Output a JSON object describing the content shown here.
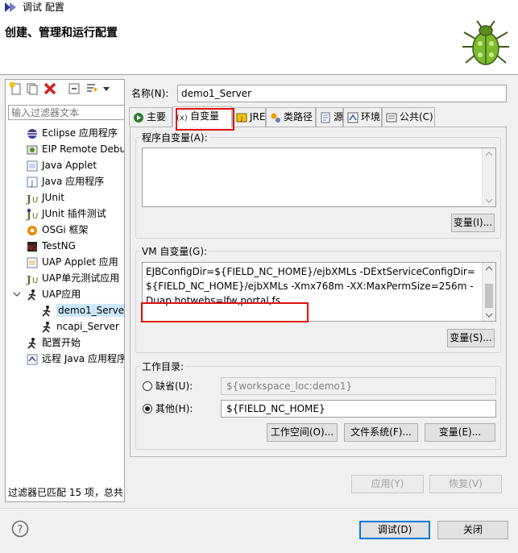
{
  "window": {
    "title": "调试 配置"
  },
  "header": {
    "title": "创建、管理和运行配置"
  },
  "filter": {
    "placeholder": "输入过滤器文本"
  },
  "tree": {
    "items": [
      {
        "label": "Eclipse 应用程序",
        "icon": "eclipse-icon",
        "level": 1
      },
      {
        "label": "EIP Remote Debu",
        "icon": "eip-remote-debug-icon",
        "level": 1
      },
      {
        "label": "Java Applet",
        "icon": "java-applet-icon",
        "level": 1
      },
      {
        "label": "Java 应用程序",
        "icon": "java-application-icon",
        "level": 1
      },
      {
        "label": "JUnit",
        "icon": "junit-icon",
        "level": 1
      },
      {
        "label": "JUnit 插件测试",
        "icon": "junit-plugin-icon",
        "level": 1
      },
      {
        "label": "OSGi 框架",
        "icon": "osgi-icon",
        "level": 1
      },
      {
        "label": "TestNG",
        "icon": "testng-icon",
        "level": 1
      },
      {
        "label": "UAP Applet 应用",
        "icon": "uap-applet-icon",
        "level": 1
      },
      {
        "label": "UAP单元测试应用",
        "icon": "uap-unit-test-icon",
        "level": 1
      },
      {
        "label": "UAP应用",
        "icon": "uap-app-icon",
        "level": 1,
        "expanded": true
      },
      {
        "label": "demo1_Serve",
        "icon": "runner-icon",
        "level": 2,
        "selected": true
      },
      {
        "label": "ncapi_Server",
        "icon": "runner-icon",
        "level": 2
      },
      {
        "label": "配置开始",
        "icon": "config-start-icon",
        "level": 1
      },
      {
        "label": "远程 Java 应用程序",
        "icon": "remote-java-icon",
        "level": 1
      }
    ]
  },
  "left_status": "过滤器已匹配 15 项，总共",
  "name": {
    "label": "名称(N):",
    "value": "demo1_Server"
  },
  "tabs": [
    {
      "label": "主要",
      "icon": "main-tab-icon"
    },
    {
      "label": "自变量",
      "icon": "arguments-tab-icon",
      "active": true
    },
    {
      "label": "JRE",
      "icon": "jre-tab-icon"
    },
    {
      "label": "类路径",
      "icon": "classpath-tab-icon"
    },
    {
      "label": "源",
      "icon": "source-tab-icon"
    },
    {
      "label": "环境",
      "icon": "environment-tab-icon"
    },
    {
      "label": "公共(C)",
      "icon": "common-tab-icon"
    }
  ],
  "program_args": {
    "label": "程序自变量(A):",
    "value": "",
    "variables_button": "变量(I)..."
  },
  "vm_args": {
    "label": "VM 自变量(G):",
    "value": "Dnc.runMode=develop -Dnc.server.location=${FIELD_NC_HOME} -DEJBConfigDir=${FIELD_NC_HOME}/ejbXMLs -DExtServiceConfigDir=${FIELD_NC_HOME}/ejbXMLs -Xmx768m -XX:MaxPermSize=256m -Duap.hotwebs=lfw,portal,fs",
    "variables_button": "变量(S)..."
  },
  "working_dir": {
    "label": "工作目录:",
    "default_label": "缺省(U):",
    "default_value": "${workspace_loc:demo1}",
    "other_label": "其他(H):",
    "other_value": "${FIELD_NC_HOME}",
    "selected": "other",
    "workspace_button": "工作空间(O)...",
    "filesystem_button": "文件系统(F)...",
    "variables_button": "变量(E)..."
  },
  "apply_button": "应用(Y)",
  "revert_button": "恢复(V)",
  "debug_button": "调试(D)",
  "close_button": "关闭",
  "colors": {
    "highlight": "#e01010",
    "selection": "#cce8ff",
    "accent": "#0078d7"
  }
}
